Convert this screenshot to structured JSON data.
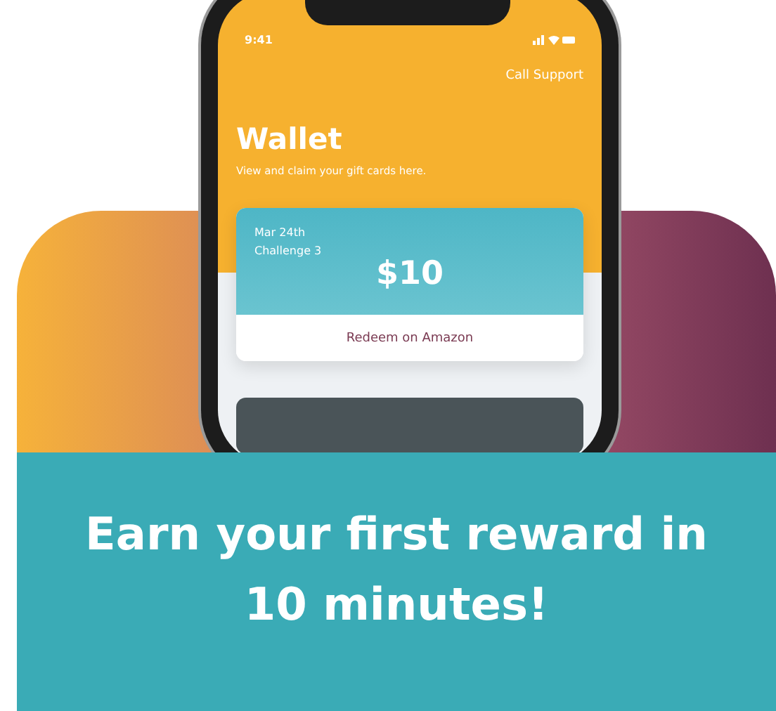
{
  "phone": {
    "status_time": "9:41",
    "support_link": "Call Support",
    "title": "Wallet",
    "subtitle": "View and claim your gift cards here.",
    "card": {
      "date": "Mar 24th",
      "challenge": "Challenge 3",
      "amount": "$10",
      "action": "Redeem on Amazon"
    }
  },
  "banner": {
    "headline": "Earn your first reward in 10 minutes!"
  }
}
